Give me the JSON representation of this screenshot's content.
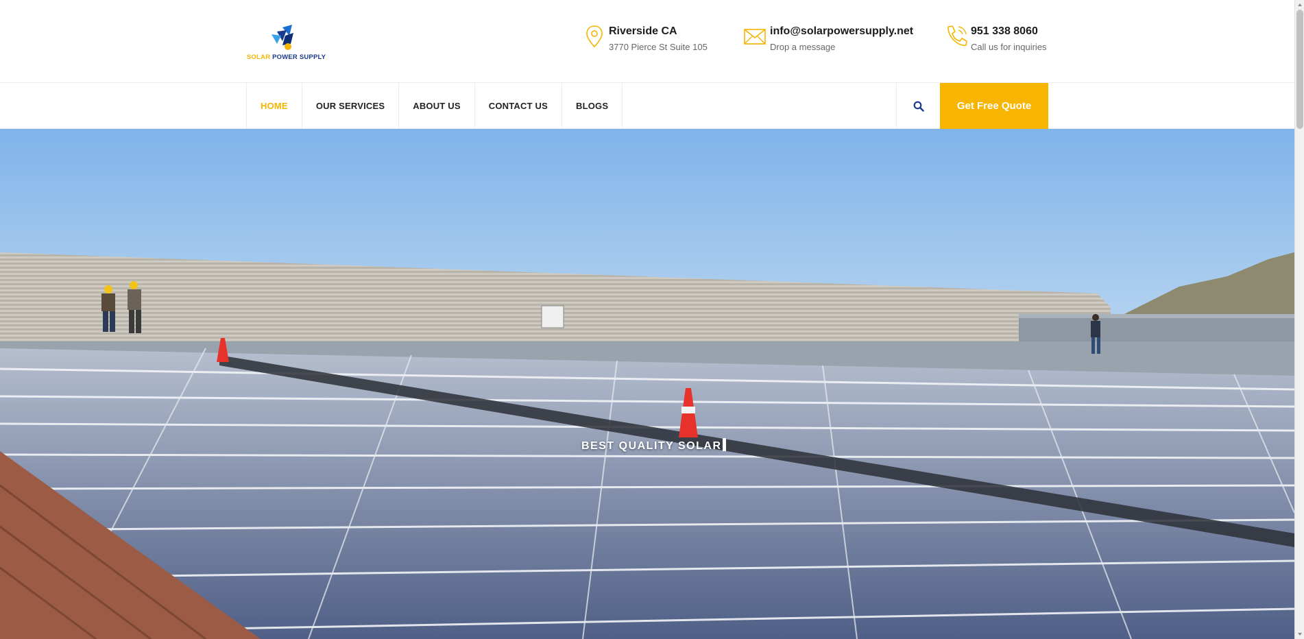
{
  "brand": {
    "logo_word1": "SOLAR",
    "logo_word2": "POWER SUPPLY",
    "accent_color": "#f7b500",
    "brand_blue": "#1a3a8a"
  },
  "header": {
    "contacts": [
      {
        "icon": "map-pin-icon",
        "title": "Riverside CA",
        "subtitle": "3770 Pierce St Suite 105"
      },
      {
        "icon": "envelope-icon",
        "title": "info@solarpowersupply.net",
        "subtitle": "Drop a message"
      },
      {
        "icon": "phone-icon",
        "title": "951 338 8060",
        "subtitle": "Call us for inquiries"
      }
    ]
  },
  "nav": {
    "items": [
      {
        "label": "HOME",
        "active": true
      },
      {
        "label": "OUR SERVICES",
        "active": false
      },
      {
        "label": "ABOUT US",
        "active": false
      },
      {
        "label": "CONTACT US",
        "active": false
      },
      {
        "label": "BLOGS",
        "active": false
      }
    ],
    "search_icon": "search-icon",
    "quote_button": "Get Free Quote"
  },
  "hero": {
    "caption": "BEST QUALITY SOLAR",
    "image_subject": "rooftop solar panel array with workers"
  }
}
